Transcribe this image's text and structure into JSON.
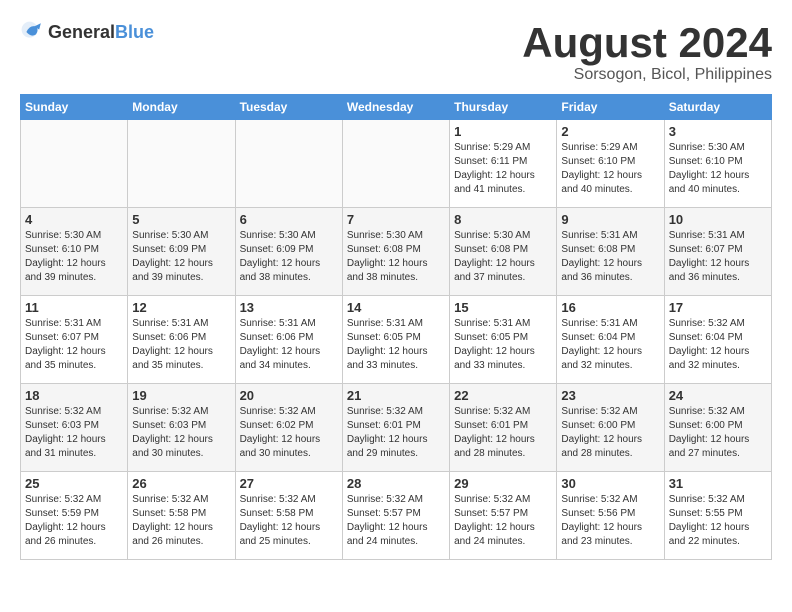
{
  "header": {
    "logo": {
      "general": "General",
      "blue": "Blue"
    },
    "title": "August 2024",
    "subtitle": "Sorsogon, Bicol, Philippines"
  },
  "weekdays": [
    "Sunday",
    "Monday",
    "Tuesday",
    "Wednesday",
    "Thursday",
    "Friday",
    "Saturday"
  ],
  "weeks": [
    [
      {
        "day": "",
        "info": ""
      },
      {
        "day": "",
        "info": ""
      },
      {
        "day": "",
        "info": ""
      },
      {
        "day": "",
        "info": ""
      },
      {
        "day": "1",
        "info": "Sunrise: 5:29 AM\nSunset: 6:11 PM\nDaylight: 12 hours\nand 41 minutes."
      },
      {
        "day": "2",
        "info": "Sunrise: 5:29 AM\nSunset: 6:10 PM\nDaylight: 12 hours\nand 40 minutes."
      },
      {
        "day": "3",
        "info": "Sunrise: 5:30 AM\nSunset: 6:10 PM\nDaylight: 12 hours\nand 40 minutes."
      }
    ],
    [
      {
        "day": "4",
        "info": "Sunrise: 5:30 AM\nSunset: 6:10 PM\nDaylight: 12 hours\nand 39 minutes."
      },
      {
        "day": "5",
        "info": "Sunrise: 5:30 AM\nSunset: 6:09 PM\nDaylight: 12 hours\nand 39 minutes."
      },
      {
        "day": "6",
        "info": "Sunrise: 5:30 AM\nSunset: 6:09 PM\nDaylight: 12 hours\nand 38 minutes."
      },
      {
        "day": "7",
        "info": "Sunrise: 5:30 AM\nSunset: 6:08 PM\nDaylight: 12 hours\nand 38 minutes."
      },
      {
        "day": "8",
        "info": "Sunrise: 5:30 AM\nSunset: 6:08 PM\nDaylight: 12 hours\nand 37 minutes."
      },
      {
        "day": "9",
        "info": "Sunrise: 5:31 AM\nSunset: 6:08 PM\nDaylight: 12 hours\nand 36 minutes."
      },
      {
        "day": "10",
        "info": "Sunrise: 5:31 AM\nSunset: 6:07 PM\nDaylight: 12 hours\nand 36 minutes."
      }
    ],
    [
      {
        "day": "11",
        "info": "Sunrise: 5:31 AM\nSunset: 6:07 PM\nDaylight: 12 hours\nand 35 minutes."
      },
      {
        "day": "12",
        "info": "Sunrise: 5:31 AM\nSunset: 6:06 PM\nDaylight: 12 hours\nand 35 minutes."
      },
      {
        "day": "13",
        "info": "Sunrise: 5:31 AM\nSunset: 6:06 PM\nDaylight: 12 hours\nand 34 minutes."
      },
      {
        "day": "14",
        "info": "Sunrise: 5:31 AM\nSunset: 6:05 PM\nDaylight: 12 hours\nand 33 minutes."
      },
      {
        "day": "15",
        "info": "Sunrise: 5:31 AM\nSunset: 6:05 PM\nDaylight: 12 hours\nand 33 minutes."
      },
      {
        "day": "16",
        "info": "Sunrise: 5:31 AM\nSunset: 6:04 PM\nDaylight: 12 hours\nand 32 minutes."
      },
      {
        "day": "17",
        "info": "Sunrise: 5:32 AM\nSunset: 6:04 PM\nDaylight: 12 hours\nand 32 minutes."
      }
    ],
    [
      {
        "day": "18",
        "info": "Sunrise: 5:32 AM\nSunset: 6:03 PM\nDaylight: 12 hours\nand 31 minutes."
      },
      {
        "day": "19",
        "info": "Sunrise: 5:32 AM\nSunset: 6:03 PM\nDaylight: 12 hours\nand 30 minutes."
      },
      {
        "day": "20",
        "info": "Sunrise: 5:32 AM\nSunset: 6:02 PM\nDaylight: 12 hours\nand 30 minutes."
      },
      {
        "day": "21",
        "info": "Sunrise: 5:32 AM\nSunset: 6:01 PM\nDaylight: 12 hours\nand 29 minutes."
      },
      {
        "day": "22",
        "info": "Sunrise: 5:32 AM\nSunset: 6:01 PM\nDaylight: 12 hours\nand 28 minutes."
      },
      {
        "day": "23",
        "info": "Sunrise: 5:32 AM\nSunset: 6:00 PM\nDaylight: 12 hours\nand 28 minutes."
      },
      {
        "day": "24",
        "info": "Sunrise: 5:32 AM\nSunset: 6:00 PM\nDaylight: 12 hours\nand 27 minutes."
      }
    ],
    [
      {
        "day": "25",
        "info": "Sunrise: 5:32 AM\nSunset: 5:59 PM\nDaylight: 12 hours\nand 26 minutes."
      },
      {
        "day": "26",
        "info": "Sunrise: 5:32 AM\nSunset: 5:58 PM\nDaylight: 12 hours\nand 26 minutes."
      },
      {
        "day": "27",
        "info": "Sunrise: 5:32 AM\nSunset: 5:58 PM\nDaylight: 12 hours\nand 25 minutes."
      },
      {
        "day": "28",
        "info": "Sunrise: 5:32 AM\nSunset: 5:57 PM\nDaylight: 12 hours\nand 24 minutes."
      },
      {
        "day": "29",
        "info": "Sunrise: 5:32 AM\nSunset: 5:57 PM\nDaylight: 12 hours\nand 24 minutes."
      },
      {
        "day": "30",
        "info": "Sunrise: 5:32 AM\nSunset: 5:56 PM\nDaylight: 12 hours\nand 23 minutes."
      },
      {
        "day": "31",
        "info": "Sunrise: 5:32 AM\nSunset: 5:55 PM\nDaylight: 12 hours\nand 22 minutes."
      }
    ]
  ]
}
